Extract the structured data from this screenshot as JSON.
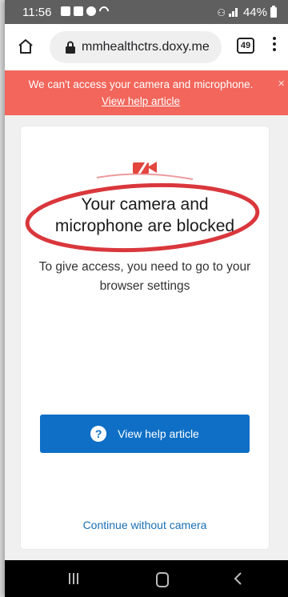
{
  "status_bar": {
    "time": "11:56",
    "battery_text": "44%"
  },
  "browser": {
    "url": "mmhealthctrs.doxy.me",
    "tab_count": "49"
  },
  "alert": {
    "message": "We can't access your camera and microphone.",
    "link": "View help article",
    "close": "×",
    "color": "#f2665b"
  },
  "main": {
    "title_line1": "Your camera and",
    "title_line2": "microphone are blocked",
    "description": "To give access, you need to go to your browser settings",
    "help_button": "View help article",
    "help_icon": "?",
    "continue_link": "Continue without camera",
    "button_color": "#0f6fc6",
    "highlight_color": "#d9373c"
  },
  "icons": {
    "status": [
      "gallery-icon",
      "message-icon",
      "chrome-icon",
      "wifi-icon",
      "nfc-icon",
      "signal-icon",
      "battery-icon"
    ],
    "browser": [
      "home-icon",
      "lock-icon",
      "menu-icon"
    ],
    "content": [
      "camera-blocked-icon",
      "help-icon"
    ],
    "nav": [
      "recents-icon",
      "home-nav-icon",
      "back-icon"
    ]
  }
}
